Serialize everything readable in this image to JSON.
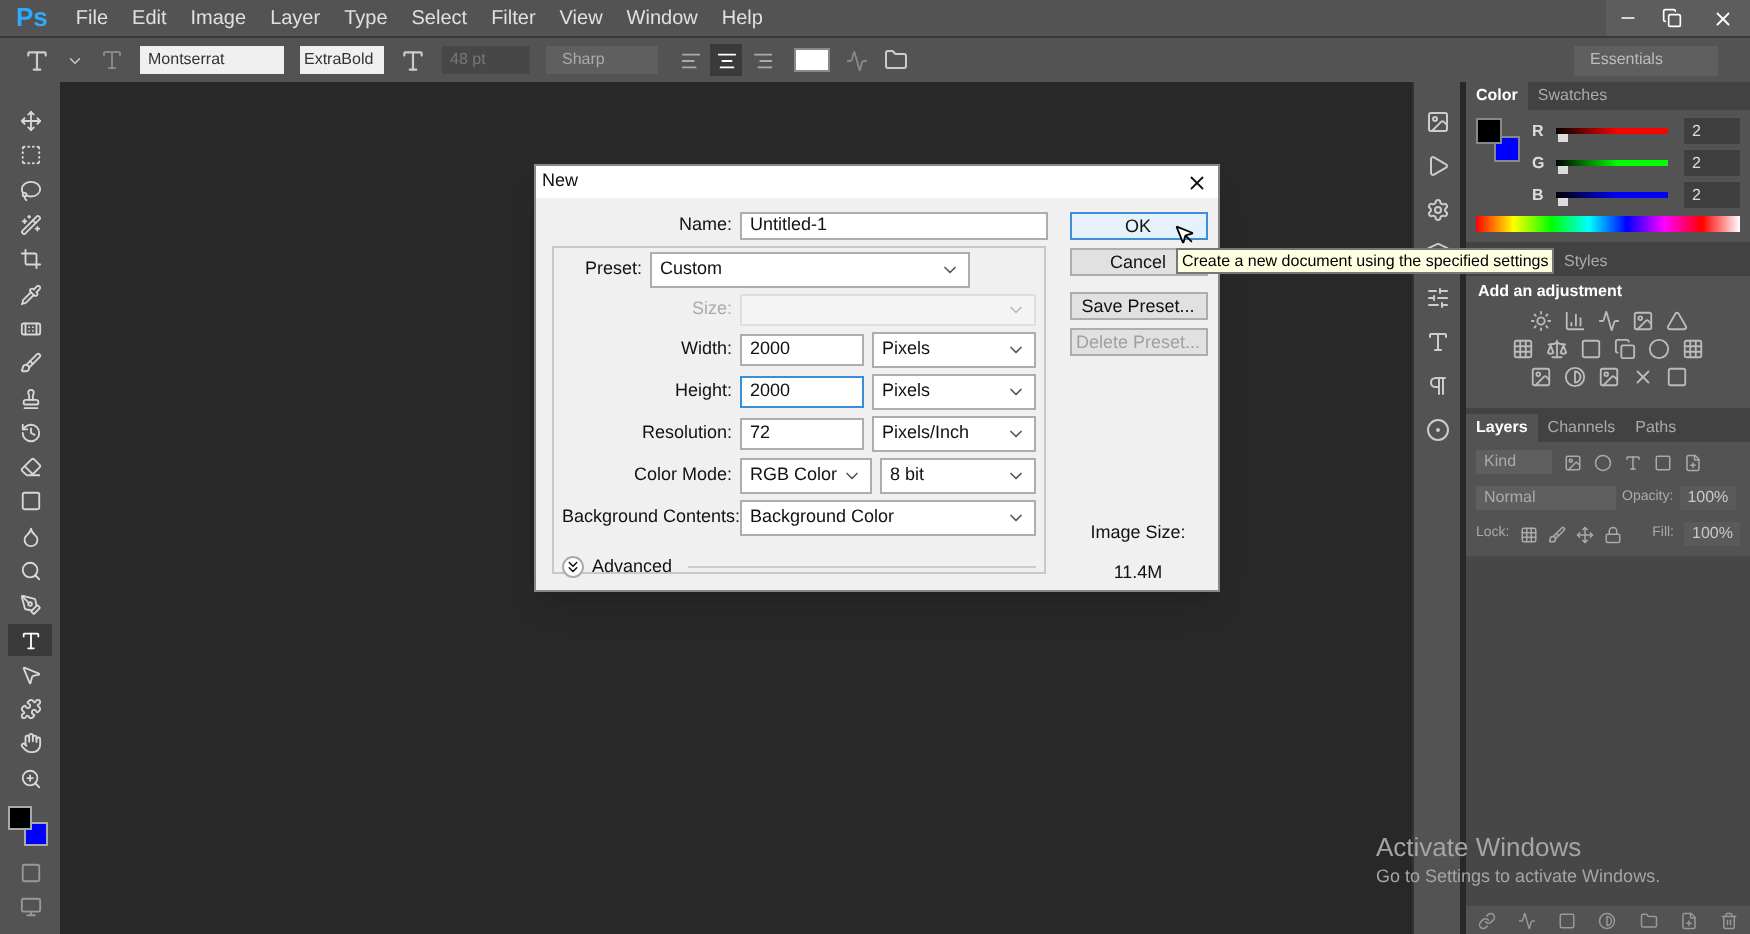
{
  "menu": [
    "File",
    "Edit",
    "Image",
    "Layer",
    "Type",
    "Select",
    "Filter",
    "View",
    "Window",
    "Help"
  ],
  "logo": "Ps",
  "options_bar": {
    "font_family": "Montserrat",
    "font_style": "ExtraBold",
    "font_size": "48 pt",
    "antialias": "Sharp",
    "align": [
      {
        "selected": false
      },
      {
        "selected": true
      },
      {
        "selected": false
      }
    ],
    "workspace": "Essentials"
  },
  "tools": [
    {
      "selected": false
    },
    {
      "selected": false
    },
    {
      "selected": false
    },
    {
      "selected": false
    },
    {
      "selected": false
    },
    {
      "selected": false
    },
    {
      "selected": false
    },
    {
      "selected": false
    },
    {
      "selected": false
    },
    {
      "selected": false
    },
    {
      "selected": false
    },
    {
      "selected": false
    },
    {
      "selected": false
    },
    {
      "selected": false
    },
    {
      "selected": false
    },
    {
      "selected": true
    },
    {
      "selected": false
    },
    {
      "selected": false
    },
    {
      "selected": false
    },
    {
      "selected": false
    }
  ],
  "swatches": [
    {
      "color": "#000000"
    },
    {
      "color": "#0000ff"
    }
  ],
  "dialog": {
    "title": "New",
    "name_label": "Name:",
    "name": "Untitled-1",
    "preset_label": "Preset:",
    "preset": "Custom",
    "size_label": "Size:",
    "rows": [
      {
        "label": "Width:",
        "value": "2000",
        "unit": "Pixels",
        "focused": false
      },
      {
        "label": "Height:",
        "value": "2000",
        "unit": "Pixels",
        "focused": true
      },
      {
        "label": "Resolution:",
        "value": "72",
        "unit": "Pixels/Inch",
        "focused": false
      }
    ],
    "color_mode_label": "Color Mode:",
    "color_mode": "RGB Color",
    "bit_depth": "8 bit",
    "background_label": "Background Contents:",
    "background": "Background Color",
    "advanced": "Advanced",
    "buttons": [
      {
        "label": "OK",
        "disabled": false,
        "default": true
      },
      {
        "label": "Cancel",
        "disabled": false,
        "default": false
      },
      {
        "label": "Save Preset...",
        "disabled": false,
        "default": false
      },
      {
        "label": "Delete Preset...",
        "disabled": true,
        "default": false
      }
    ],
    "image_size_label": "Image Size:",
    "image_size": "11.4M"
  },
  "tooltip": "Create a new document using the specified settings",
  "color_panel": {
    "tabs": [
      {
        "label": "Color",
        "selected": true
      },
      {
        "label": "Swatches",
        "selected": false
      }
    ],
    "channels": [
      {
        "name": "R",
        "value": "2",
        "level": 0.01,
        "color": "#ff0000"
      },
      {
        "name": "G",
        "value": "2",
        "level": 0.01,
        "color": "#00ff00"
      },
      {
        "name": "B",
        "value": "2",
        "level": 0.01,
        "color": "#0000ff"
      }
    ]
  },
  "adjust_panel": {
    "tabs": [
      {
        "label": "Styles",
        "selected": false
      }
    ],
    "heading": "Add an adjustment"
  },
  "layers_panel": {
    "tabs": [
      {
        "label": "Layers",
        "selected": true
      },
      {
        "label": "Channels",
        "selected": false
      },
      {
        "label": "Paths",
        "selected": false
      }
    ],
    "filter": "Kind",
    "blend_mode": "Normal",
    "opacity_label": "Opacity:",
    "opacity": "100%",
    "lock_label": "Lock:",
    "fill_label": "Fill:",
    "fill": "100%"
  },
  "activation": {
    "title": "Activate Windows",
    "subtitle": "Go to Settings to activate Windows."
  }
}
